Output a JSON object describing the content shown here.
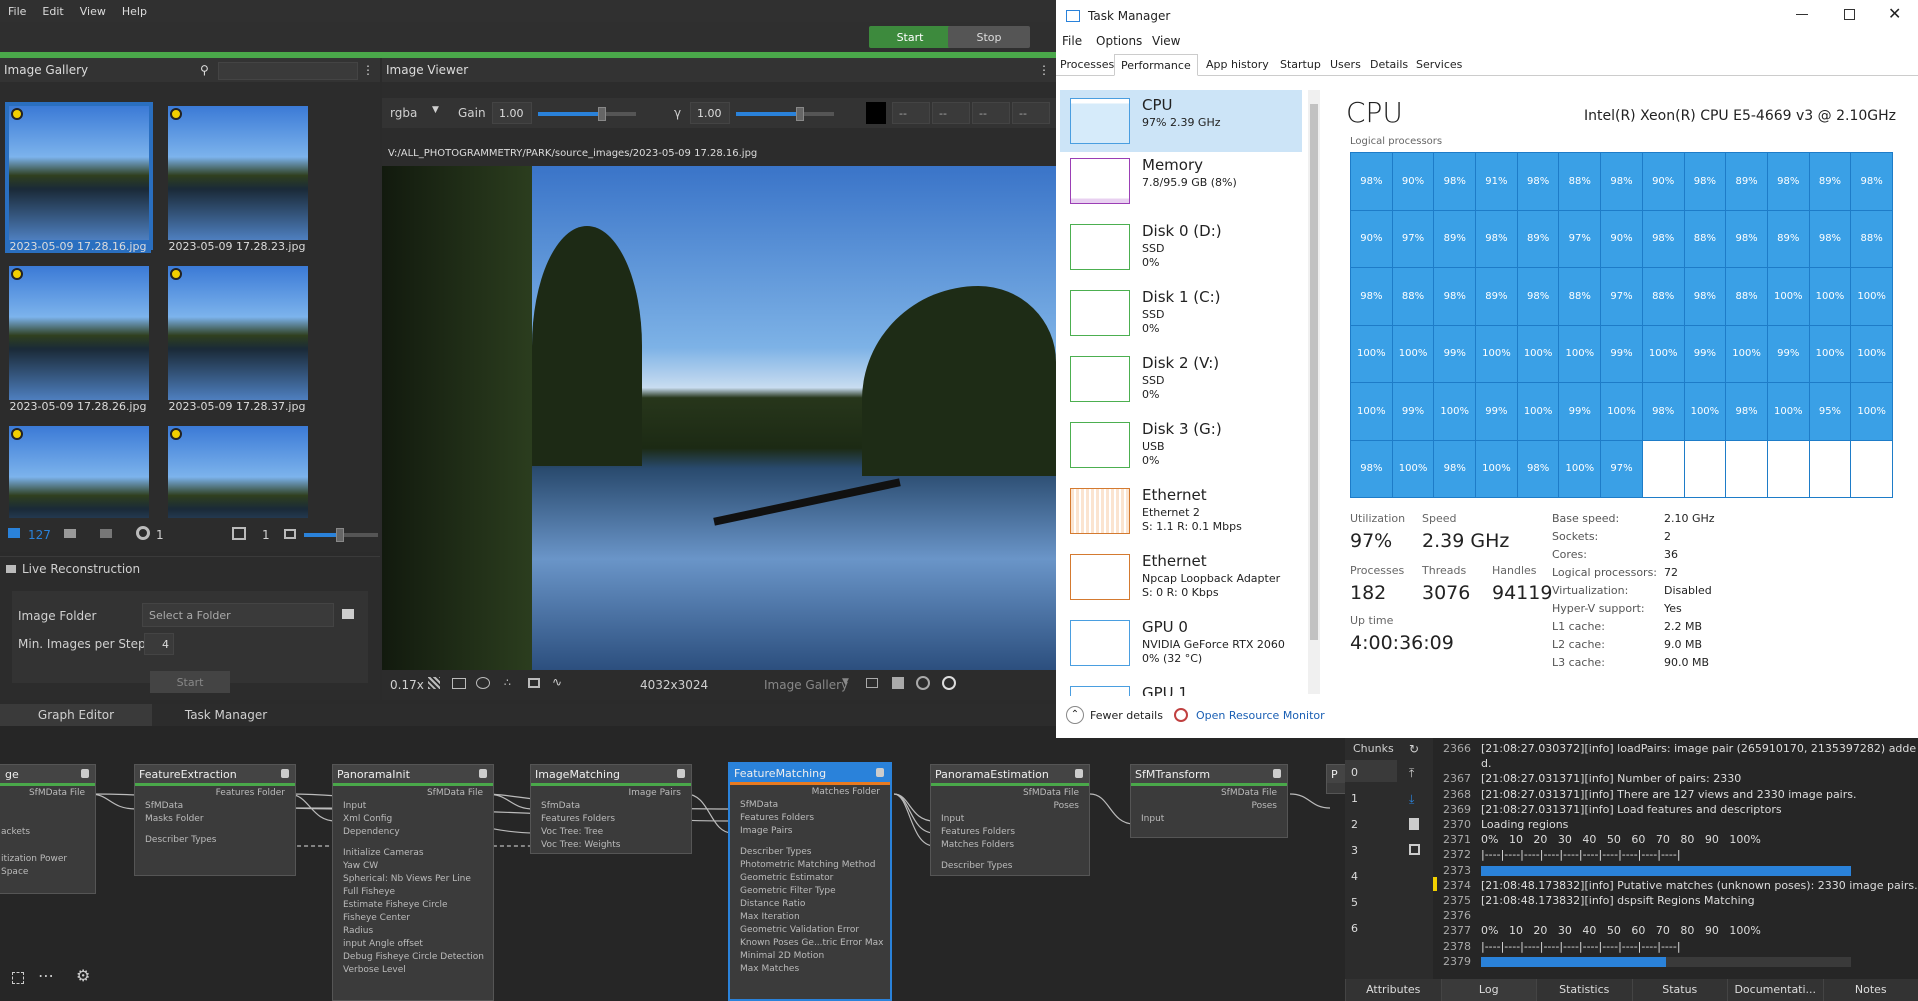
{
  "menubar": {
    "items": [
      "File",
      "Edit",
      "View",
      "Help"
    ]
  },
  "controls": {
    "start_label": "Start",
    "stop_label": "Stop"
  },
  "gallery": {
    "title": "Image Gallery",
    "items": [
      {
        "label": "2023-05-09 17.28.16.jpg"
      },
      {
        "label": "2023-05-09 17.28.23.jpg"
      },
      {
        "label": "2023-05-09 17.28.26.jpg"
      },
      {
        "label": "2023-05-09 17.28.37.jpg"
      },
      {
        "label": ""
      },
      {
        "label": ""
      }
    ],
    "footer": {
      "image_count": "127",
      "intrinsic_count": "1",
      "views_count": "1"
    }
  },
  "live": {
    "title": "Live Reconstruction",
    "image_folder_label": "Image Folder",
    "image_folder_placeholder": "Select a Folder",
    "min_images_label": "Min. Images per Step",
    "min_images_value": "4",
    "start_label": "Start"
  },
  "viewer": {
    "title": "Image Viewer",
    "channel": "rgba",
    "gain_label": "Gain",
    "gain_value": "1.00",
    "gamma_label": "γ",
    "gamma_value": "1.00",
    "dash": "--",
    "path": "V:/ALL_PHOTOGRAMMETRY/PARK/source_images/2023-05-09 17.28.16.jpg",
    "zoom": "0.17x",
    "resolution": "4032x3024",
    "source": "Image Gallery"
  },
  "bottom_tabs": {
    "graph": "Graph Editor",
    "task": "Task Manager"
  },
  "nodes": {
    "n0": {
      "title": "ge",
      "out": "SfMData File",
      "rows": [
        "ackets",
        "itization Power",
        " Space"
      ]
    },
    "n1": {
      "title": "FeatureExtraction",
      "out": "Features Folder",
      "rows": [
        "SfMData",
        "Masks Folder",
        "Describer Types"
      ]
    },
    "n2": {
      "title": "PanoramaInit",
      "out": "SfMData File",
      "rows": [
        "Input",
        "Xml Config",
        "Dependency",
        "Initialize Cameras",
        "Yaw CW",
        "Spherical: Nb Views Per Line",
        "Full Fisheye",
        "Estimate Fisheye Circle",
        "Fisheye Center",
        "Radius",
        "input Angle offset",
        "Debug Fisheye Circle Detection",
        "Verbose Level"
      ]
    },
    "n3": {
      "title": "ImageMatching",
      "out": "Image Pairs",
      "rows": [
        "SfmData",
        "Features Folders",
        "Voc Tree: Tree",
        "Voc Tree: Weights"
      ]
    },
    "n4": {
      "title": "FeatureMatching",
      "out": "Matches Folder",
      "rows": [
        "SfMData",
        "Features Folders",
        "Image Pairs",
        "Describer Types",
        "Photometric Matching Method",
        "Geometric Estimator",
        "Geometric Filter Type",
        "Distance Ratio",
        "Max Iteration",
        "Geometric Validation Error",
        "Known Poses Ge...tric Error Max",
        "Minimal 2D Motion",
        "Max Matches"
      ]
    },
    "n5": {
      "title": "PanoramaEstimation",
      "out": "SfMData File",
      "out2": "Poses",
      "rows": [
        "Input",
        "Features Folders",
        "Matches Folders",
        "Describer Types"
      ]
    },
    "n6": {
      "title": "SfMTransform",
      "out": "SfMData File",
      "out2": "Poses",
      "rows": [
        "Input"
      ]
    },
    "n7": {
      "title": "P"
    }
  },
  "taskmanager": {
    "title": "Task Manager",
    "menu": [
      "File",
      "Options",
      "View"
    ],
    "tabs": [
      "Processes",
      "Performance",
      "App history",
      "Startup",
      "Users",
      "Details",
      "Services"
    ],
    "side": [
      {
        "name": "CPU",
        "sub1": "97% 2.39 GHz",
        "sub2": "",
        "sub3": ""
      },
      {
        "name": "Memory",
        "sub1": "7.8/95.9 GB (8%)",
        "sub2": "",
        "sub3": ""
      },
      {
        "name": "Disk 0 (D:)",
        "sub1": "SSD",
        "sub2": "0%",
        "sub3": ""
      },
      {
        "name": "Disk 1 (C:)",
        "sub1": "SSD",
        "sub2": "0%",
        "sub3": ""
      },
      {
        "name": "Disk 2 (V:)",
        "sub1": "SSD",
        "sub2": "0%",
        "sub3": ""
      },
      {
        "name": "Disk 3 (G:)",
        "sub1": "USB",
        "sub2": "0%",
        "sub3": ""
      },
      {
        "name": "Ethernet",
        "sub1": "Ethernet 2",
        "sub2": "S: 1.1 R: 0.1 Mbps",
        "sub3": ""
      },
      {
        "name": "Ethernet",
        "sub1": "Npcap Loopback Adapter",
        "sub2": "S: 0 R: 0 Kbps",
        "sub3": ""
      },
      {
        "name": "GPU 0",
        "sub1": "NVIDIA GeForce RTX 2060",
        "sub2": "0% (32 °C)",
        "sub3": ""
      },
      {
        "name": "GPU 1",
        "sub1": "",
        "sub2": "",
        "sub3": ""
      }
    ],
    "cpu_title": "CPU",
    "cpu_model": "Intel(R) Xeon(R) CPU E5-4669 v3 @ 2.10GHz",
    "logical_label": "Logical processors",
    "cores": [
      "98%",
      "90%",
      "98%",
      "91%",
      "98%",
      "88%",
      "98%",
      "90%",
      "98%",
      "89%",
      "98%",
      "89%",
      "98%",
      "90%",
      "97%",
      "89%",
      "98%",
      "89%",
      "97%",
      "90%",
      "98%",
      "88%",
      "98%",
      "89%",
      "98%",
      "88%",
      "98%",
      "88%",
      "98%",
      "89%",
      "98%",
      "88%",
      "97%",
      "88%",
      "98%",
      "88%",
      "100%",
      "100%",
      "100%",
      "100%",
      "100%",
      "99%",
      "100%",
      "100%",
      "100%",
      "99%",
      "100%",
      "99%",
      "100%",
      "99%",
      "100%",
      "100%",
      "100%",
      "99%",
      "100%",
      "99%",
      "100%",
      "99%",
      "100%",
      "98%",
      "100%",
      "98%",
      "100%",
      "95%",
      "100%",
      "98%",
      "100%",
      "98%",
      "100%",
      "98%",
      "100%",
      "97%"
    ],
    "utilization_label": "Utilization",
    "utilization": "97%",
    "speed_label": "Speed",
    "speed": "2.39 GHz",
    "processes_label": "Processes",
    "processes": "182",
    "threads_label": "Threads",
    "threads": "3076",
    "handles_label": "Handles",
    "handles": "94119",
    "uptime_label": "Up time",
    "uptime": "4:00:36:09",
    "specs": [
      {
        "k": "Base speed:",
        "v": "2.10 GHz"
      },
      {
        "k": "Sockets:",
        "v": "2"
      },
      {
        "k": "Cores:",
        "v": "36"
      },
      {
        "k": "Logical processors:",
        "v": "72"
      },
      {
        "k": "Virtualization:",
        "v": "Disabled"
      },
      {
        "k": "Hyper-V support:",
        "v": "Yes"
      },
      {
        "k": "L1 cache:",
        "v": "2.2 MB"
      },
      {
        "k": "L2 cache:",
        "v": "9.0 MB"
      },
      {
        "k": "L3 cache:",
        "v": "90.0 MB"
      }
    ],
    "fewer_details": "Fewer details",
    "open_monitor": "Open Resource Monitor"
  },
  "chunks": {
    "title": "Chunks",
    "items": [
      "0",
      "1",
      "2",
      "3",
      "4",
      "5",
      "6"
    ]
  },
  "log": {
    "lines": [
      {
        "n": "2366",
        "t": "[21:08:27.030372][info] loadPairs: image pair (265910170, 2135397282) adde"
      },
      {
        "n": "",
        "t": "d."
      },
      {
        "n": "2367",
        "t": "[21:08:27.031371][info] Number of pairs: 2330"
      },
      {
        "n": "2368",
        "t": "[21:08:27.031371][info] There are 127 views and 2330 image pairs."
      },
      {
        "n": "2369",
        "t": "[21:08:27.031371][info] Load features and descriptors"
      },
      {
        "n": "2370",
        "t": "Loading regions"
      },
      {
        "n": "2371",
        "t": "0%   10   20   30   40   50   60   70   80   90   100%"
      },
      {
        "n": "2372",
        "t": "|----|----|----|----|----|----|----|----|----|----|"
      },
      {
        "n": "2373",
        "t": ""
      },
      {
        "n": "2374",
        "t": "[21:08:48.173832][info] Putative matches (unknown poses): 2330 image pairs."
      },
      {
        "n": "2375",
        "t": "[21:08:48.173832][info] dspsift Regions Matching"
      },
      {
        "n": "2376",
        "t": ""
      },
      {
        "n": "2377",
        "t": "0%   10   20   30   40   50   60   70   80   90   100%"
      },
      {
        "n": "2378",
        "t": "|----|----|----|----|----|----|----|----|----|----|"
      },
      {
        "n": "2379",
        "t": ""
      }
    ],
    "progress_2373": 1.0,
    "progress_2379": 0.5
  },
  "bottom_right_tabs": [
    "Attributes",
    "Log",
    "Statistics",
    "Status",
    "Documentati...",
    "Notes"
  ]
}
